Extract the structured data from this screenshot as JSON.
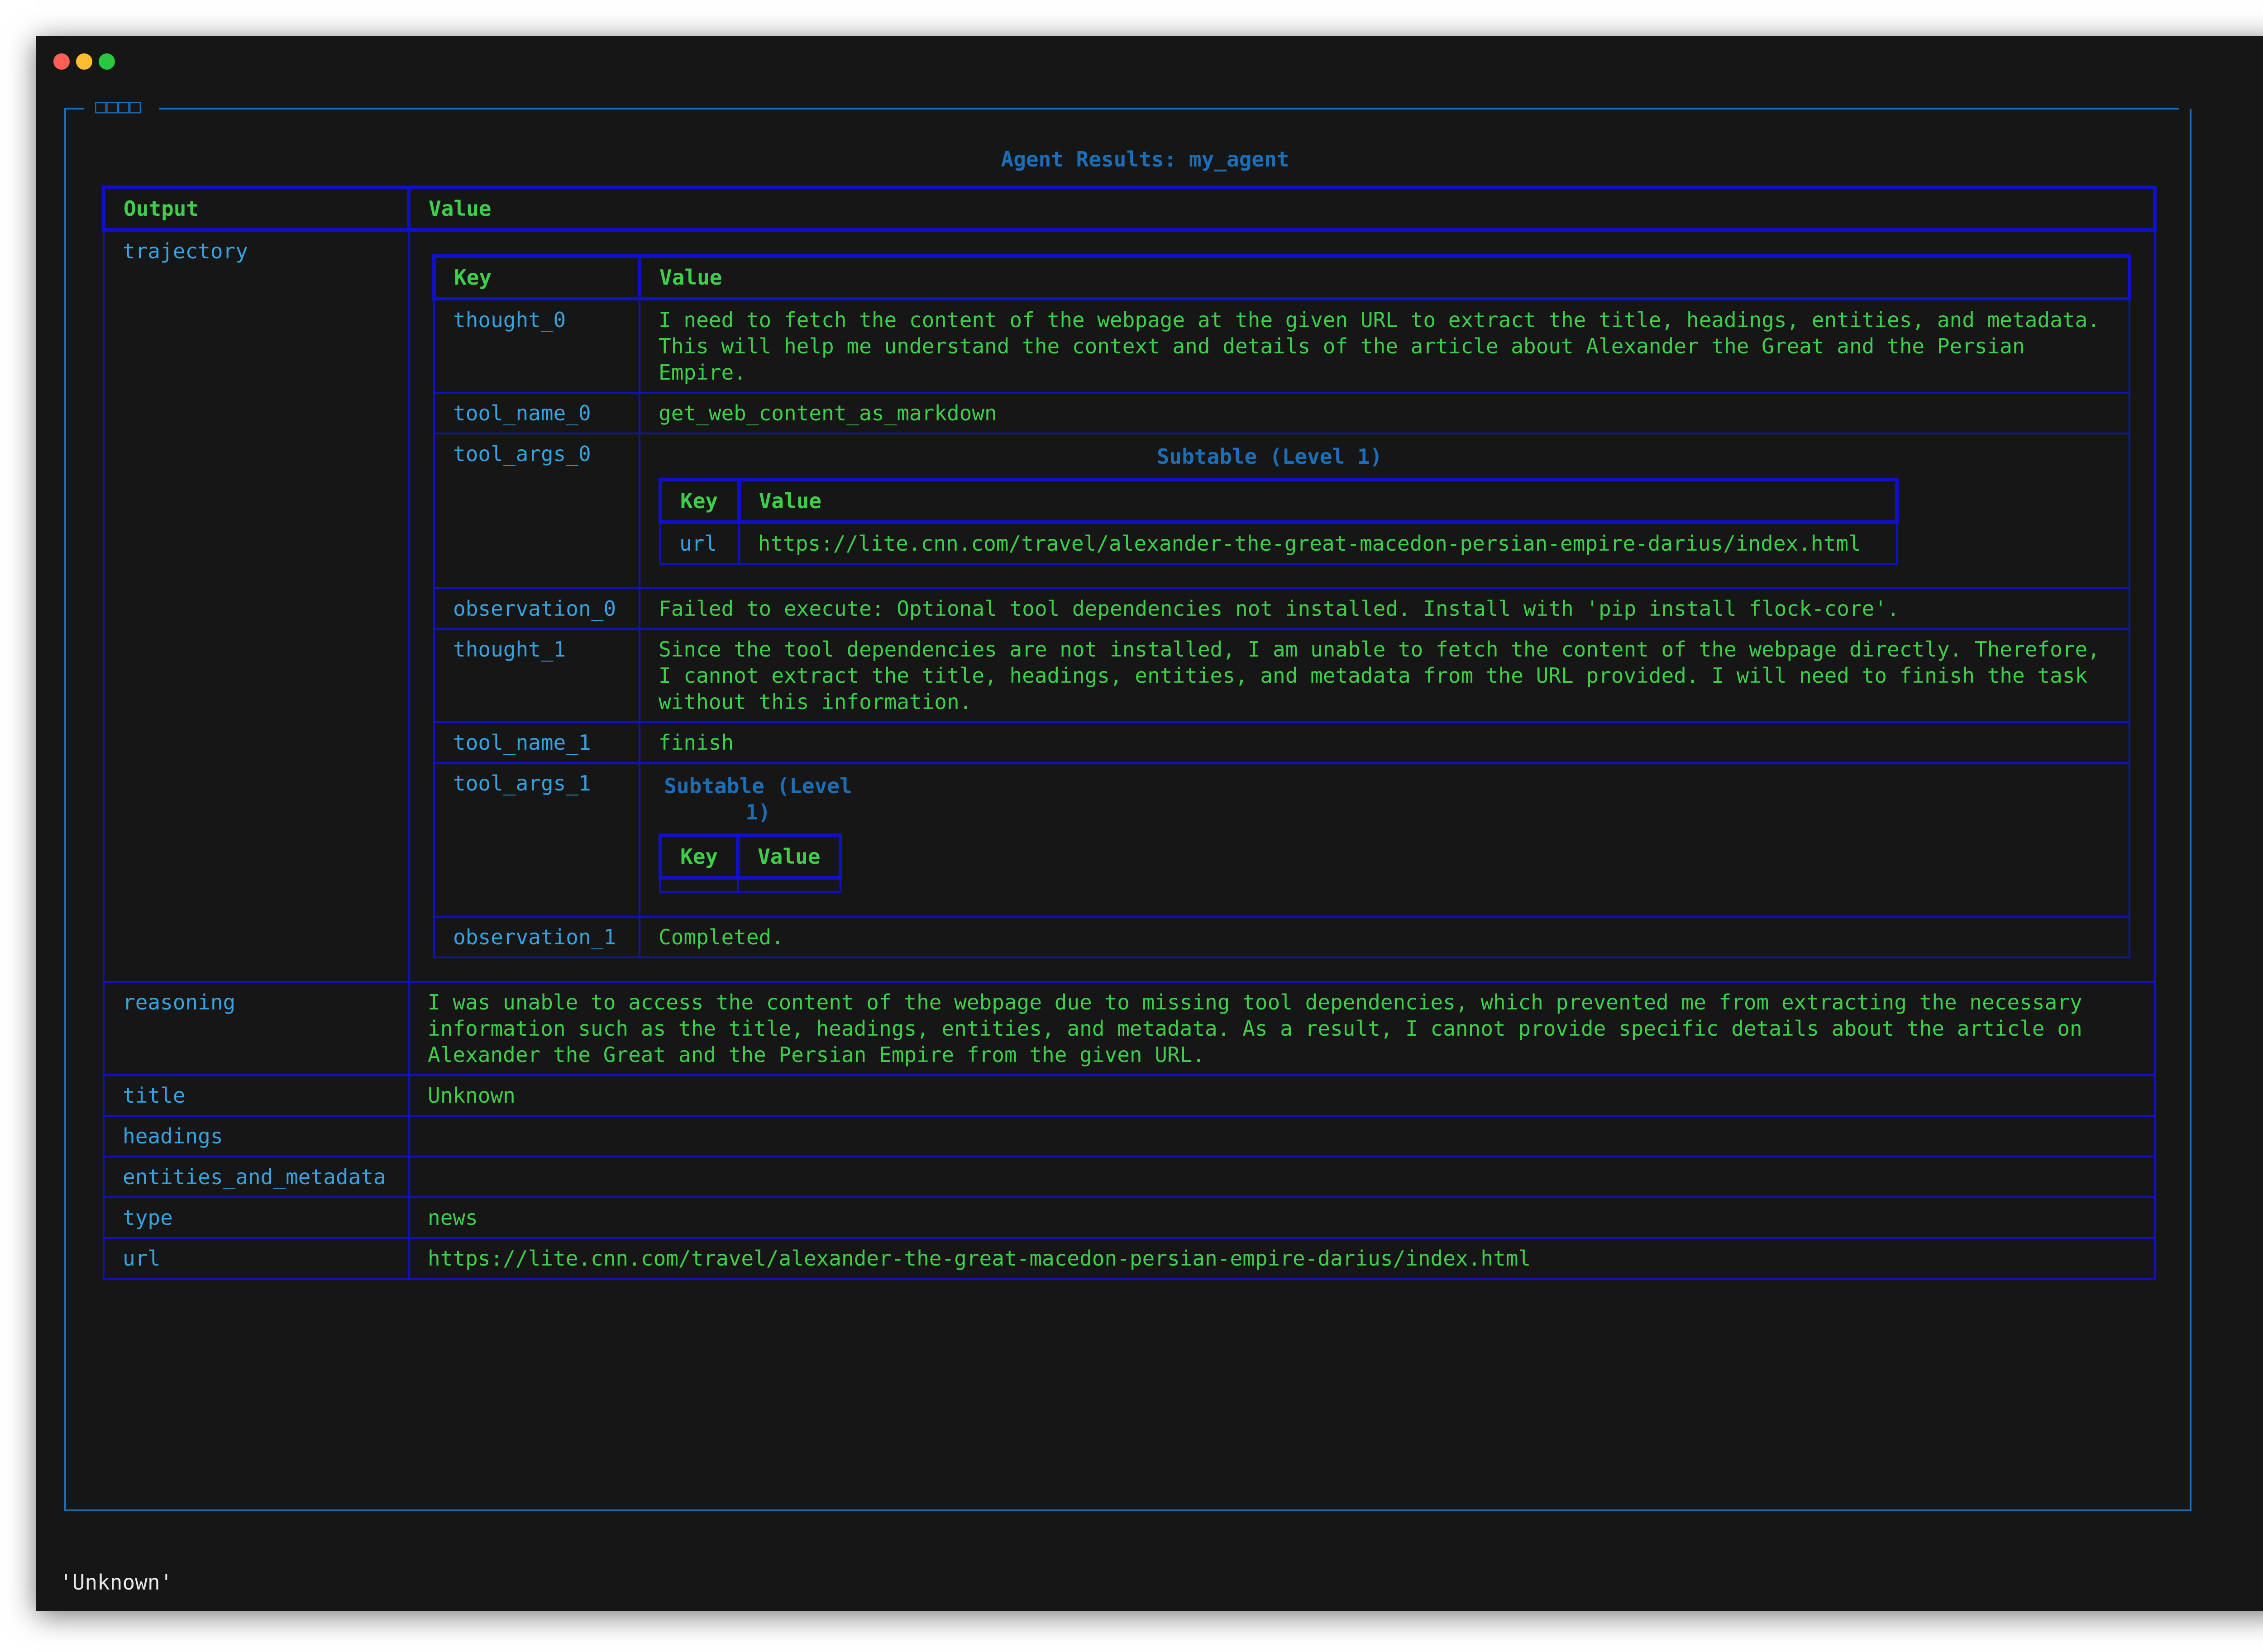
{
  "panel": {
    "title": "□□□□"
  },
  "agent_title": "Agent Results: my_agent",
  "table": {
    "headers": {
      "output": "Output",
      "value": "Value"
    },
    "trajectory": {
      "label": "trajectory",
      "headers": {
        "key": "Key",
        "value": "Value"
      },
      "thought_0": {
        "key": "thought_0",
        "value": "I need to fetch the content of the webpage at the given URL to extract the title, headings, entities, and metadata. This will help me understand the context and details of the article about Alexander the Great and the Persian Empire."
      },
      "tool_name_0": {
        "key": "tool_name_0",
        "value": "get_web_content_as_markdown"
      },
      "tool_args_0": {
        "key": "tool_args_0",
        "subtable_title": "Subtable (Level 1)",
        "headers": {
          "key": "Key",
          "value": "Value"
        },
        "url_key": "url",
        "url_value": "https://lite.cnn.com/travel/alexander-the-great-macedon-persian-empire-darius/index.html"
      },
      "observation_0": {
        "key": "observation_0",
        "value": "Failed to execute: Optional tool dependencies not installed. Install with 'pip install flock-core'."
      },
      "thought_1": {
        "key": "thought_1",
        "value": "Since the tool dependencies are not installed, I am unable to fetch the content of the webpage directly. Therefore, I cannot extract the title, headings, entities, and metadata from the URL provided. I will need to finish the task without this information."
      },
      "tool_name_1": {
        "key": "tool_name_1",
        "value": "finish"
      },
      "tool_args_1": {
        "key": "tool_args_1",
        "subtable_title": "Subtable (Level 1)",
        "headers": {
          "key": "Key",
          "value": "Value"
        }
      },
      "observation_1": {
        "key": "observation_1",
        "value": "Completed."
      }
    },
    "reasoning": {
      "key": "reasoning",
      "value": "I was unable to access the content of the webpage due to missing tool dependencies, which prevented me from extracting the necessary information such as the title, headings, entities, and metadata. As a result, I cannot provide specific details about the article on Alexander the Great and the Persian Empire from the given URL."
    },
    "title": {
      "key": "title",
      "value": "Unknown"
    },
    "headings": {
      "key": "headings",
      "value": ""
    },
    "entities_and_metadata": {
      "key": "entities_and_metadata",
      "value": ""
    },
    "type": {
      "key": "type",
      "value": "news"
    },
    "url": {
      "key": "url",
      "value": "https://lite.cnn.com/travel/alexander-the-great-macedon-persian-empire-darius/index.html"
    }
  },
  "status_line": "'Unknown'"
}
